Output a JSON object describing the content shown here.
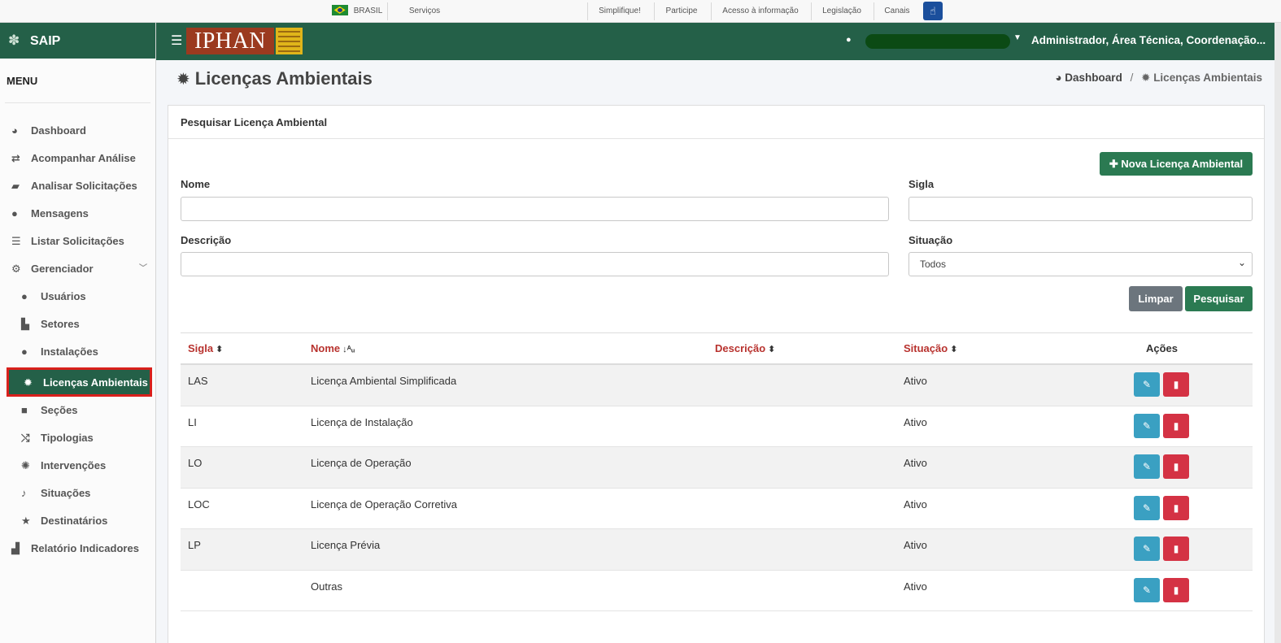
{
  "gov_bar": {
    "country": "BRASIL",
    "links": [
      "Serviços",
      "Simplifique!",
      "Participe",
      "Acesso à informação",
      "Legislação",
      "Canais"
    ]
  },
  "sidebar": {
    "brand": "SAIP",
    "menu_title": "MENU",
    "items": [
      {
        "label": "Dashboard",
        "icon": "dashboard-icon",
        "glyph": "◕"
      },
      {
        "label": "Acompanhar Análise",
        "icon": "exchange-icon",
        "glyph": "⇄"
      },
      {
        "label": "Analisar Solicitações",
        "icon": "book-icon",
        "glyph": "▰"
      },
      {
        "label": "Mensagens",
        "icon": "comments-icon",
        "glyph": "●"
      },
      {
        "label": "Listar Solicitações",
        "icon": "list-icon",
        "glyph": "☰"
      },
      {
        "label": "Gerenciador",
        "icon": "cogs-icon",
        "glyph": "⚙"
      },
      {
        "label": "Usuários",
        "icon": "users-icon",
        "glyph": "●"
      },
      {
        "label": "Setores",
        "icon": "industry-icon",
        "glyph": "▙"
      },
      {
        "label": "Instalações",
        "icon": "circle-icon",
        "glyph": "●"
      },
      {
        "label": "Licenças Ambientais",
        "icon": "certificate-icon",
        "glyph": "✹"
      },
      {
        "label": "Seções",
        "icon": "square-icon",
        "glyph": "■"
      },
      {
        "label": "Tipologias",
        "icon": "random-icon",
        "glyph": "⤭"
      },
      {
        "label": "Intervenções",
        "icon": "sun-icon",
        "glyph": "✺"
      },
      {
        "label": "Situações",
        "icon": "bell-icon",
        "glyph": "♪"
      },
      {
        "label": "Destinatários",
        "icon": "star-icon",
        "glyph": "★"
      },
      {
        "label": "Relatório Indicadores",
        "icon": "area-chart-icon",
        "glyph": "▟"
      }
    ]
  },
  "header": {
    "logo_text": "IPHAN",
    "user_info": "Administrador, Área Técnica, Coordenação..."
  },
  "page": {
    "title": "Licenças Ambientais",
    "breadcrumb": {
      "home": "Dashboard",
      "current": "Licenças Ambientais"
    }
  },
  "search": {
    "card_title": "Pesquisar Licença Ambiental",
    "new_button": "Nova Licença Ambiental",
    "nome_label": "Nome",
    "sigla_label": "Sigla",
    "descricao_label": "Descrição",
    "situacao_label": "Situação",
    "situacao_value": "Todos",
    "clear_button": "Limpar",
    "search_button": "Pesquisar"
  },
  "table": {
    "columns": {
      "sigla": "Sigla",
      "nome": "Nome",
      "descricao": "Descrição",
      "situacao": "Situação",
      "acoes": "Ações"
    },
    "rows": [
      {
        "sigla": "LAS",
        "nome": "Licença Ambiental Simplificada",
        "descricao": "",
        "situacao": "Ativo"
      },
      {
        "sigla": "LI",
        "nome": "Licença de Instalação",
        "descricao": "",
        "situacao": "Ativo"
      },
      {
        "sigla": "LO",
        "nome": "Licença de Operação",
        "descricao": "",
        "situacao": "Ativo"
      },
      {
        "sigla": "LOC",
        "nome": "Licença de Operação Corretiva",
        "descricao": "",
        "situacao": "Ativo"
      },
      {
        "sigla": "LP",
        "nome": "Licença Prévia",
        "descricao": "",
        "situacao": "Ativo"
      },
      {
        "sigla": "",
        "nome": "Outras",
        "descricao": "",
        "situacao": "Ativo"
      }
    ]
  },
  "colors": {
    "primary_green": "#246048",
    "accent_red": "#b8322e",
    "edit_blue": "#3aa0c2",
    "delete_red": "#d43244"
  }
}
